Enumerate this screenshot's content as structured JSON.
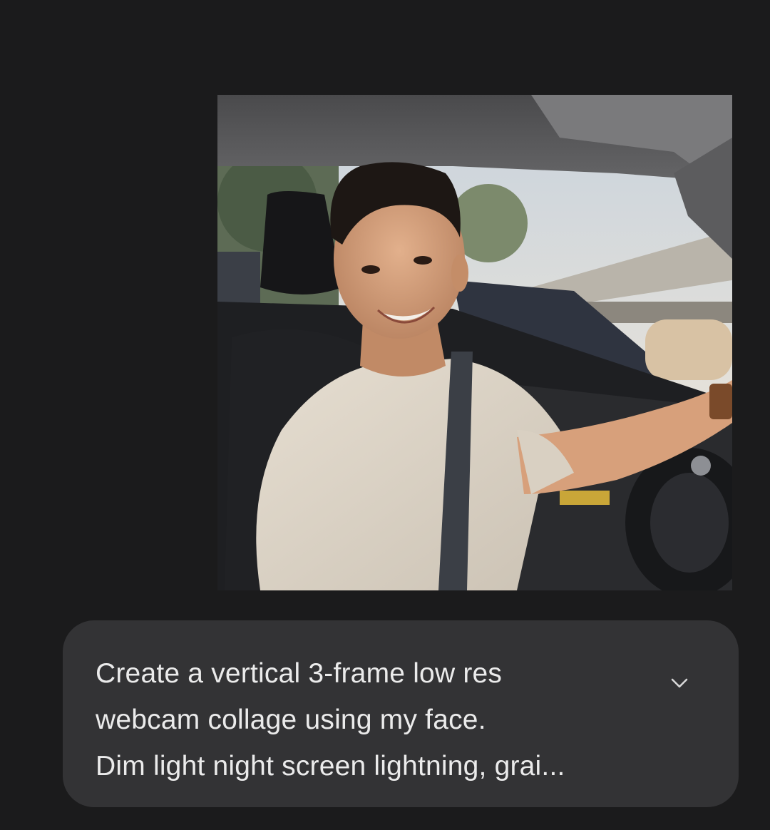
{
  "message": {
    "attachment": {
      "kind": "photo",
      "subject_icon": "photo-thumbnail"
    },
    "prompt": {
      "line1": "Create a vertical 3-frame low res",
      "line2": "webcam collage using my face.",
      "line3": "Dim light night screen lightning, grai..."
    },
    "expand_icon": "chevron-down-icon"
  },
  "colors": {
    "background": "#1b1b1c",
    "bubble": "#333335",
    "text": "#ebebeb"
  }
}
